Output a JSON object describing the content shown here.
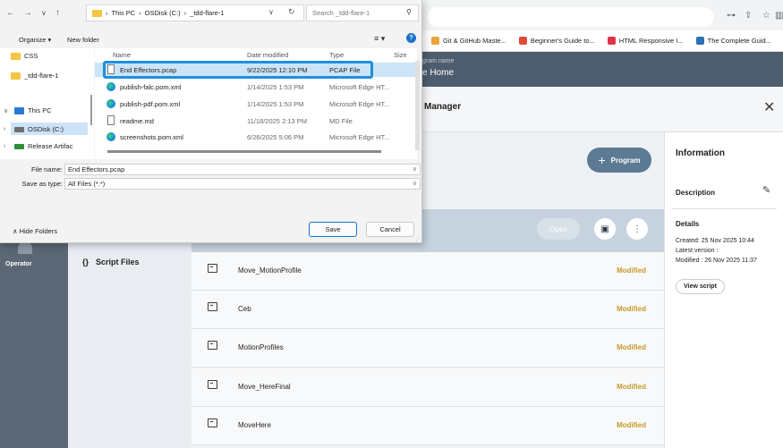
{
  "browser": {
    "bookmarks": [
      {
        "label": "Git & GitHub Maste...",
        "color": "#e8a33d"
      },
      {
        "label": "Beginner's Guide to...",
        "color": "#e04a3a"
      },
      {
        "label": "HTML Responsive I...",
        "color": "#e0334a"
      },
      {
        "label": "The Complete Guid...",
        "color": "#2f6fb5"
      }
    ]
  },
  "app": {
    "program_label": "gram name",
    "program_name": "e Home",
    "manager_title": "Manager",
    "rail_label": "Operator",
    "nav_script_files": "Script Files",
    "program_button": "Program",
    "open_button": "Open",
    "rows": [
      {
        "name": "Move_MotionProfile",
        "status": "Modified"
      },
      {
        "name": "Ceb",
        "status": "Modified"
      },
      {
        "name": "MotionProfiles",
        "status": "Modified"
      },
      {
        "name": "Move_HereFinal",
        "status": "Modified"
      },
      {
        "name": "MoveHere",
        "status": "Modified"
      }
    ],
    "info": {
      "title": "Information",
      "description_label": "Description",
      "details_label": "Details",
      "created": "Created: 25 Nov 2025 10:44",
      "latest_version": "Latest version :",
      "modified": "Modified : 26 Nov 2025 11:37",
      "view_script": "View script"
    },
    "status_color": "#c79a2a"
  },
  "dialog": {
    "path": [
      "This PC",
      "OSDisk (C:)",
      "_tdd-flare-1"
    ],
    "search_placeholder": "Search _tdd-flare-1",
    "organize": "Organize ▾",
    "new_folder": "New folder",
    "tree": {
      "css": "CSS",
      "tdd": "_tdd-flare-1",
      "this_pc": "This PC",
      "osdisk": "OSDisk (C:)",
      "release": "Release Artifac"
    },
    "columns": {
      "name": "Name",
      "date": "Date modified",
      "type": "Type",
      "size": "Size"
    },
    "files": [
      {
        "name": "End Effectors.pcap",
        "date": "9/22/2025 12:10 PM",
        "type": "PCAP File",
        "icon": "doc"
      },
      {
        "name": "publish-falc.pom.xml",
        "date": "1/14/2025 1:53 PM",
        "type": "Microsoft Edge HT...",
        "icon": "edge"
      },
      {
        "name": "publish-pdf.pom.xml",
        "date": "1/14/2025 1:53 PM",
        "type": "Microsoft Edge HT...",
        "icon": "edge"
      },
      {
        "name": "readme.md",
        "date": "11/18/2025 2:13 PM",
        "type": "MD File",
        "icon": "doc"
      },
      {
        "name": "screenshots.pom.xml",
        "date": "6/26/2025 5:06 PM",
        "type": "Microsoft Edge HT...",
        "icon": "edge"
      }
    ],
    "file_name_label": "File name:",
    "file_name_value": "End Effectors.pcap",
    "save_type_label": "Save as type:",
    "save_type_value": "All Files (*.*)",
    "hide_folders": "Hide Folders",
    "save_button": "Save",
    "cancel_button": "Cancel"
  }
}
